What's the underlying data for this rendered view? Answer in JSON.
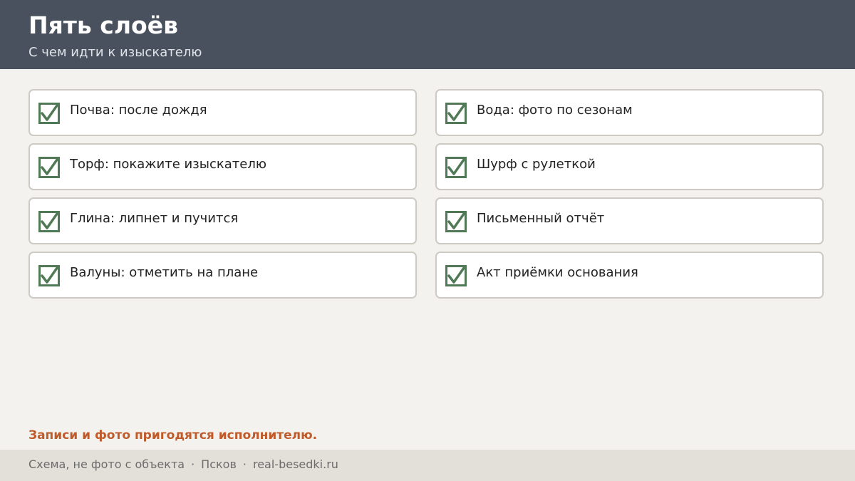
{
  "header": {
    "title": "Пять слоёв",
    "subtitle": "С чем идти к изыскателю"
  },
  "checklist": {
    "icon": "checked-checkbox-icon",
    "check_color": "#4f7a55",
    "items": [
      {
        "label": "Почва: после дождя",
        "checked": true
      },
      {
        "label": "Вода: фото по сезонам",
        "checked": true
      },
      {
        "label": "Торф: покажите изыскателю",
        "checked": true
      },
      {
        "label": "Шурф с рулеткой",
        "checked": true
      },
      {
        "label": "Глина: липнет и пучится",
        "checked": true
      },
      {
        "label": "Письменный отчёт",
        "checked": true
      },
      {
        "label": "Валуны: отметить на плане",
        "checked": true
      },
      {
        "label": "Акт приёмки основания",
        "checked": true
      }
    ]
  },
  "note": "Записи и фото пригодятся исполнителю.",
  "footer": {
    "parts": [
      "Схема, не фото с объекта",
      "Псков",
      "real-besedki.ru"
    ],
    "separator": "·"
  },
  "colors": {
    "header_bg": "#48515d",
    "page_bg": "#f4f2ee",
    "note_accent": "#bf5a2b",
    "footer_bg": "#e3e0d9"
  }
}
